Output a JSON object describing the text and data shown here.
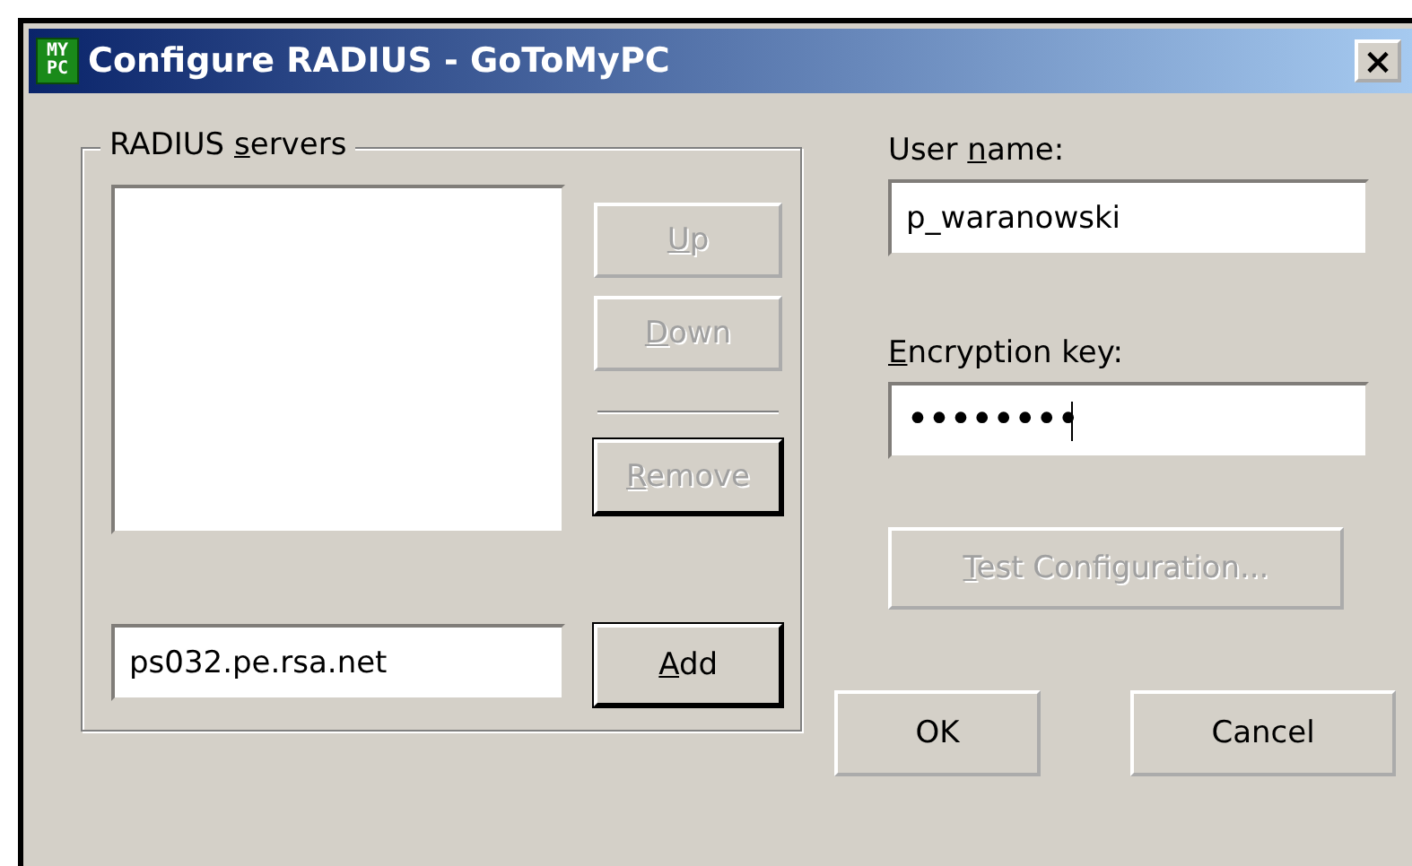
{
  "window": {
    "title": "Configure RADIUS - GoToMyPC",
    "app_icon_text": [
      "MY",
      "PC"
    ],
    "close_label": "×"
  },
  "servers_group": {
    "label": {
      "pre": "RADIUS ",
      "key": "s",
      "post": "ervers"
    },
    "buttons": [
      {
        "label": {
          "key": "U",
          "post": "p"
        },
        "disabled": true,
        "default": false
      },
      {
        "label": {
          "key": "D",
          "post": "own"
        },
        "disabled": true,
        "default": false
      },
      {
        "label": {
          "key": "R",
          "post": "emove"
        },
        "disabled": true,
        "default": true
      }
    ],
    "server_input": {
      "value": "ps032.pe.rsa.net"
    },
    "add_button": {
      "label": {
        "key": "A",
        "post": "dd"
      },
      "disabled": false,
      "default": true
    }
  },
  "user_name": {
    "label": {
      "pre": "User ",
      "key": "n",
      "post": "ame:"
    },
    "value": "p_waranowski"
  },
  "encryption_key": {
    "label": {
      "key": "E",
      "post": "ncryption key:"
    },
    "value": "••••••••"
  },
  "test_button": {
    "label": {
      "key": "T",
      "post": "est Configuration..."
    },
    "disabled": true,
    "default": false
  },
  "dialog_buttons": [
    {
      "label": {
        "pre": "OK"
      },
      "disabled": false,
      "default": false
    },
    {
      "label": {
        "pre": "Cancel"
      },
      "disabled": false,
      "default": false
    }
  ]
}
